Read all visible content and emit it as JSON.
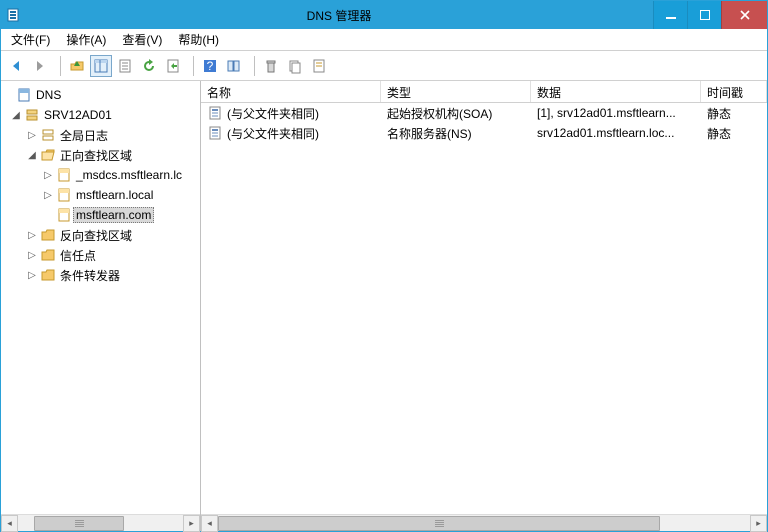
{
  "window": {
    "title": "DNS 管理器"
  },
  "menu": {
    "file": "文件(F)",
    "action": "操作(A)",
    "view": "查看(V)",
    "help": "帮助(H)"
  },
  "tree": {
    "root": "DNS",
    "server": "SRV12AD01",
    "global_log": "全局日志",
    "fwd_zone": "正向查找区域",
    "z1": "_msdcs.msftlearn.lc",
    "z2": "msftlearn.local",
    "z3": "msftlearn.com",
    "rev_zone": "反向查找区域",
    "trust": "信任点",
    "cond_fwd": "条件转发器"
  },
  "columns": {
    "name": "名称",
    "type": "类型",
    "data": "数据",
    "ts": "时间戳"
  },
  "rows": [
    {
      "name": "(与父文件夹相同)",
      "type": "起始授权机构(SOA)",
      "data": "[1], srv12ad01.msftlearn...",
      "ts": "静态"
    },
    {
      "name": "(与父文件夹相同)",
      "type": "名称服务器(NS)",
      "data": "srv12ad01.msftlearn.loc...",
      "ts": "静态"
    }
  ]
}
